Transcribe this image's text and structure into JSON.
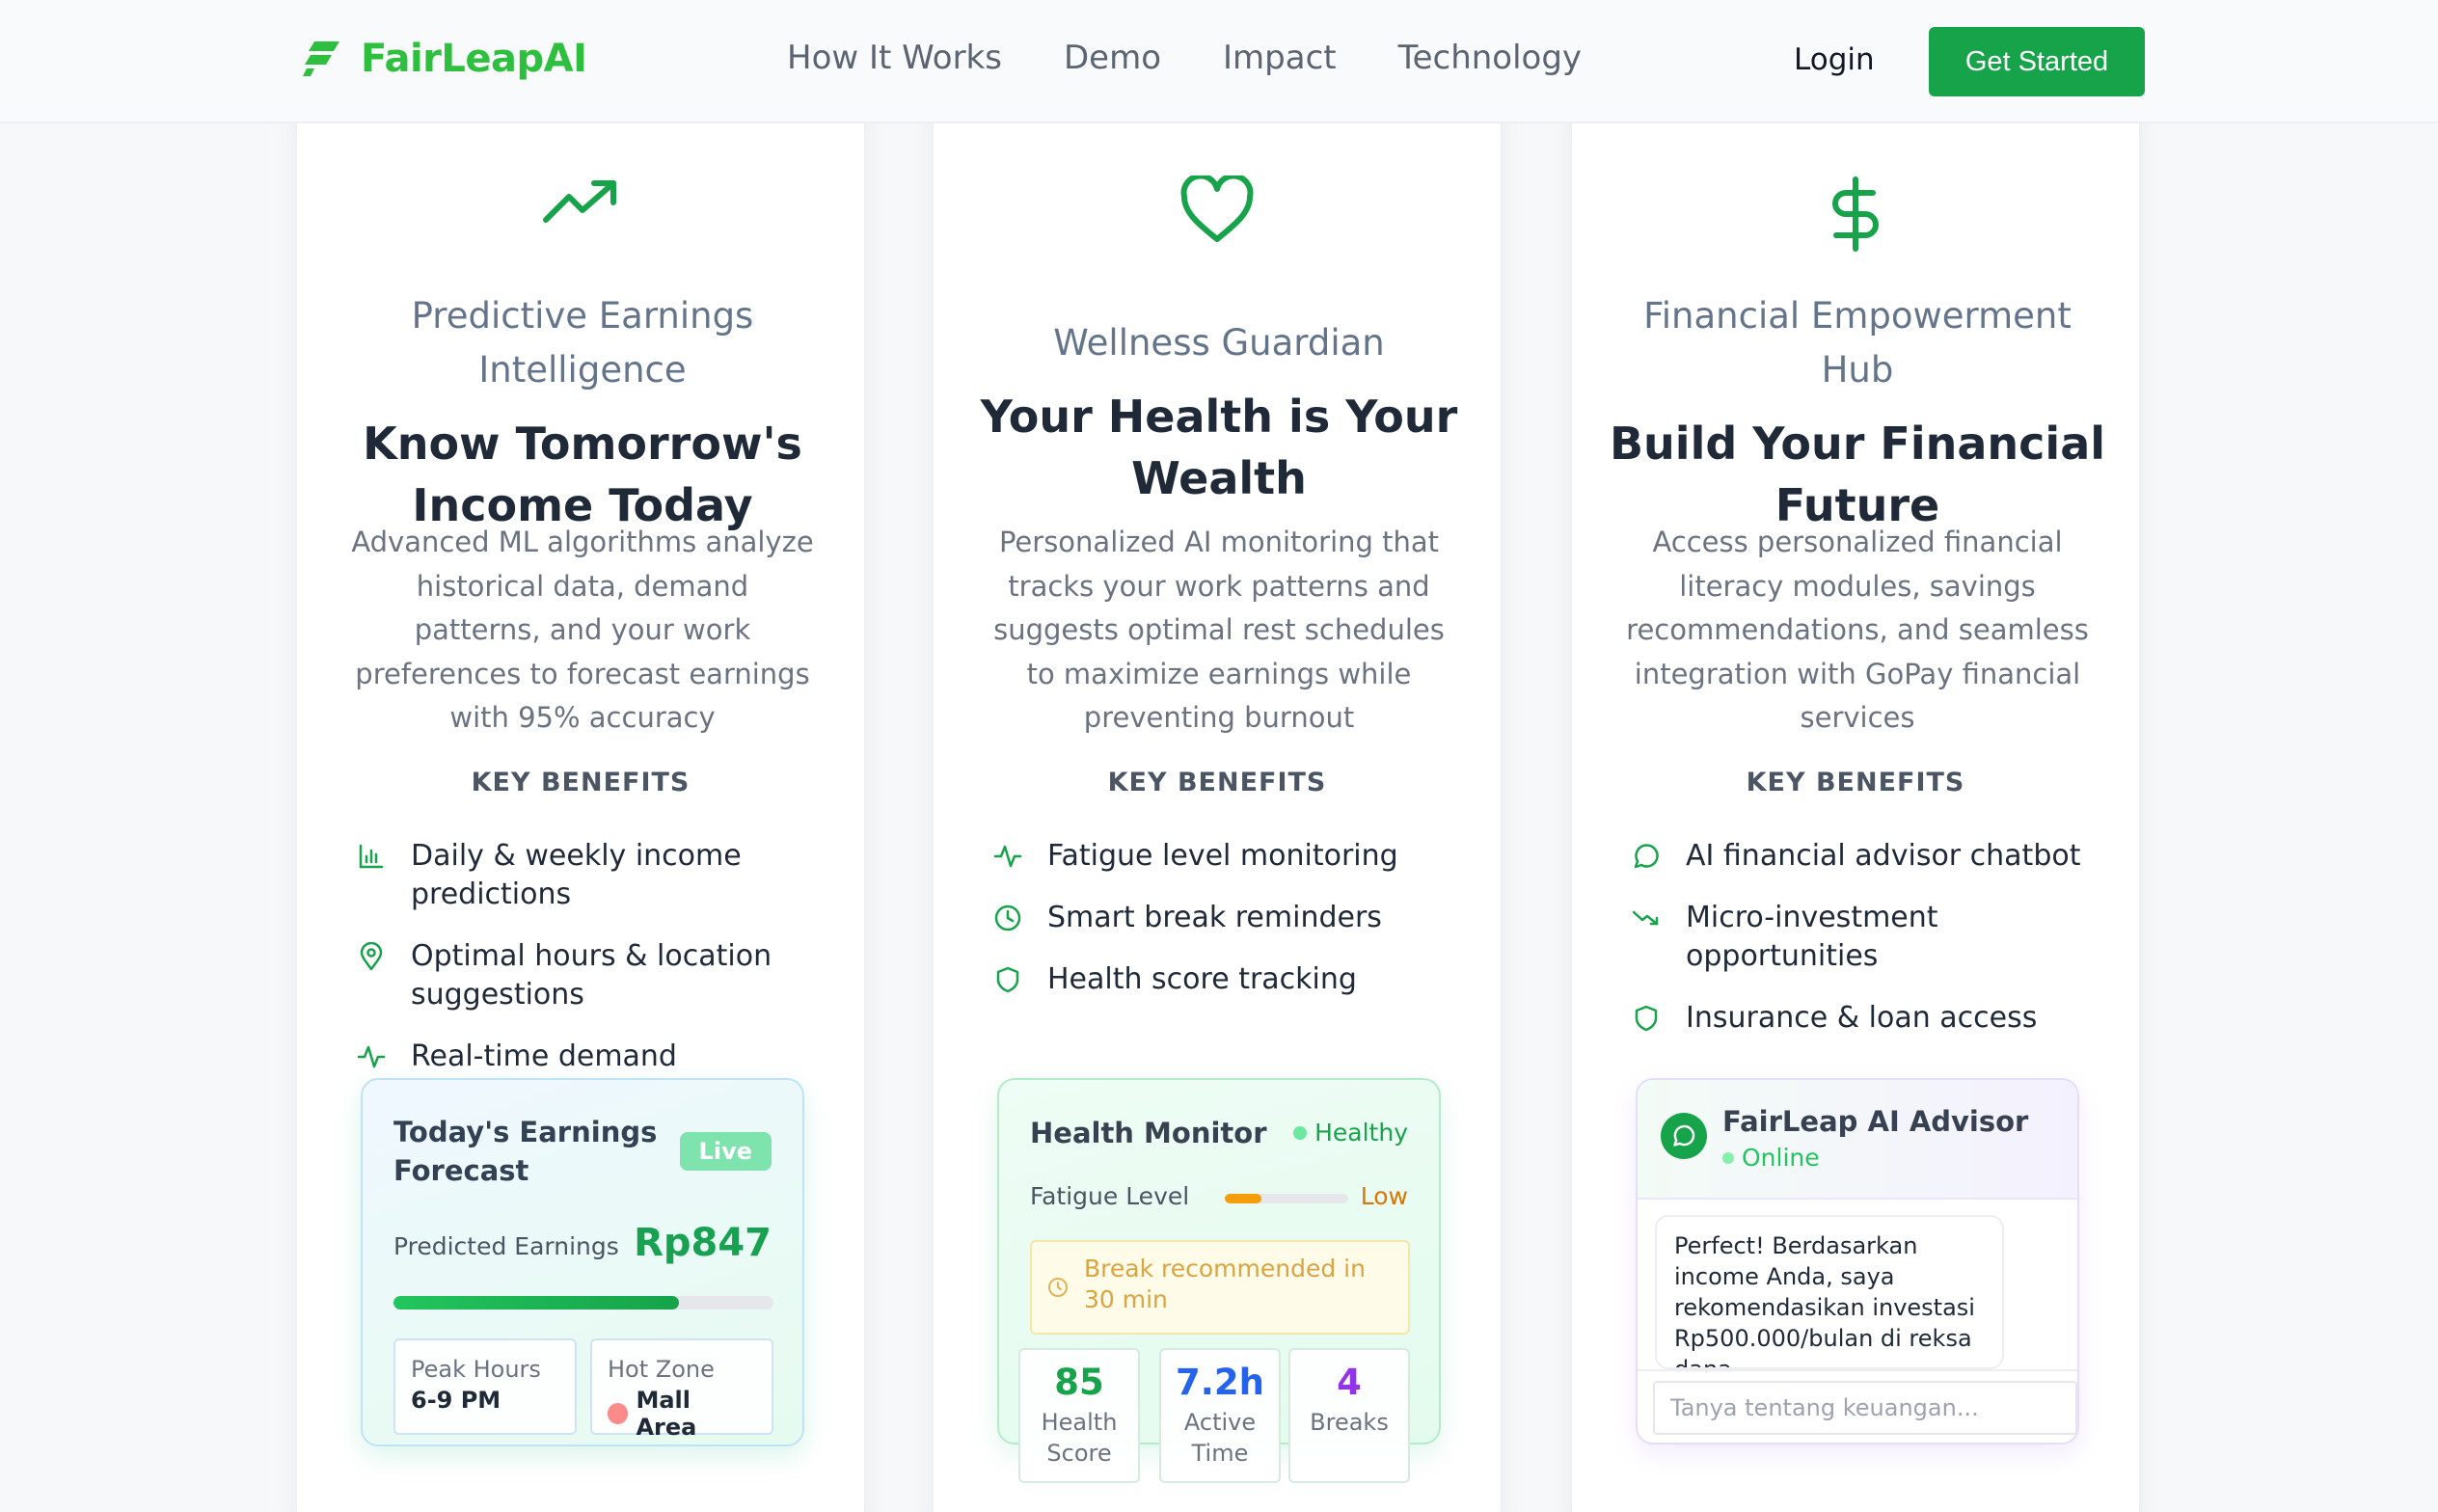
{
  "nav": {
    "brand": "FairLeapAI",
    "links": [
      "How It Works",
      "Demo",
      "Impact",
      "Technology"
    ],
    "login": "Login",
    "cta": "Get Started"
  },
  "cards": [
    {
      "icon": "trending-up-icon",
      "subtitle": "Predictive Earnings Intelligence",
      "headline": "Know Tomorrow's Income Today",
      "description": "Advanced ML algorithms analyze historical data, demand patterns, and your work preferences to forecast earnings with 95% accuracy",
      "key_benefits_label": "KEY BENEFITS",
      "benefits": [
        {
          "icon": "bar-chart-icon",
          "label": "Daily & weekly income predictions"
        },
        {
          "icon": "map-pin-icon",
          "label": "Optimal hours & location suggestions"
        },
        {
          "icon": "activity-icon",
          "label": "Real-time demand"
        }
      ]
    },
    {
      "icon": "heart-icon",
      "subtitle": "Wellness Guardian",
      "headline": "Your Health is Your Wealth",
      "description": "Personalized AI monitoring that tracks your work patterns and suggests optimal rest schedules to maximize earnings while preventing burnout",
      "key_benefits_label": "KEY BENEFITS",
      "benefits": [
        {
          "icon": "activity-icon",
          "label": "Fatigue level monitoring"
        },
        {
          "icon": "clock-icon",
          "label": "Smart break reminders"
        },
        {
          "icon": "shield-icon",
          "label": "Health score tracking"
        }
      ]
    },
    {
      "icon": "dollar-icon",
      "subtitle": "Financial Empowerment Hub",
      "headline": "Build Your Financial Future",
      "description": "Access personalized financial literacy modules, savings recommendations, and seamless integration with GoPay financial services",
      "key_benefits_label": "KEY BENEFITS",
      "benefits": [
        {
          "icon": "message-circle-icon",
          "label": "AI financial advisor chatbot"
        },
        {
          "icon": "trending-down-icon",
          "label": "Micro-investment opportunities"
        },
        {
          "icon": "shield-icon",
          "label": "Insurance & loan access"
        }
      ]
    }
  ],
  "earnings_panel": {
    "title": "Today's Earnings Forecast",
    "badge": "Live",
    "predicted_label": "Predicted Earnings",
    "predicted_value": "Rp847",
    "progress_percent": 75,
    "peak_label": "Peak Hours",
    "peak_value": "6-9 PM",
    "zone_label": "Hot Zone",
    "zone_value": "Mall Area"
  },
  "health_panel": {
    "title": "Health Monitor",
    "status": "Healthy",
    "fatigue_label": "Fatigue Level",
    "fatigue_value": "Low",
    "fatigue_percent": 30,
    "break_text": "Break recommended in 30 min",
    "stats": [
      {
        "value": "85",
        "label": "Health Score",
        "color": "#16a34a"
      },
      {
        "value": "7.2h",
        "label": "Active Time",
        "color": "#2563eb"
      },
      {
        "value": "4",
        "label": "Breaks",
        "color": "#9333ea"
      }
    ]
  },
  "advisor_panel": {
    "name": "FairLeap AI Advisor",
    "status": "Online",
    "message": "Perfect! Berdasarkan income Anda, saya rekomendasikan investasi Rp500.000/bulan di reksa dana",
    "input_placeholder": "Tanya tentang keuangan..."
  },
  "colors": {
    "brand": "#2fbf3e",
    "accent": "#16a34a",
    "icon": "#16a34a"
  }
}
